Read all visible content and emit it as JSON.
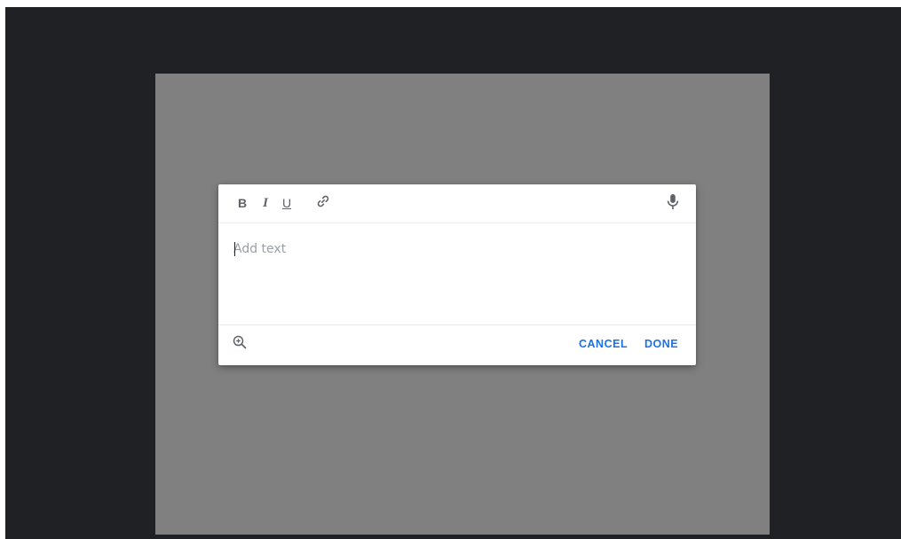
{
  "editor": {
    "placeholder": "Add text",
    "value": ""
  },
  "toolbar": {
    "bold_label": "B",
    "italic_label": "I",
    "underline_label": "U",
    "link_icon": "link-icon",
    "mic_icon": "microphone-icon"
  },
  "footer": {
    "zoom_icon": "zoom-in-icon",
    "cancel_label": "CANCEL",
    "done_label": "DONE"
  },
  "colors": {
    "app_background": "#202125",
    "canvas_background": "#808080",
    "dialog_background": "#ffffff",
    "accent": "#1a73e8",
    "icon": "#5f6368"
  }
}
